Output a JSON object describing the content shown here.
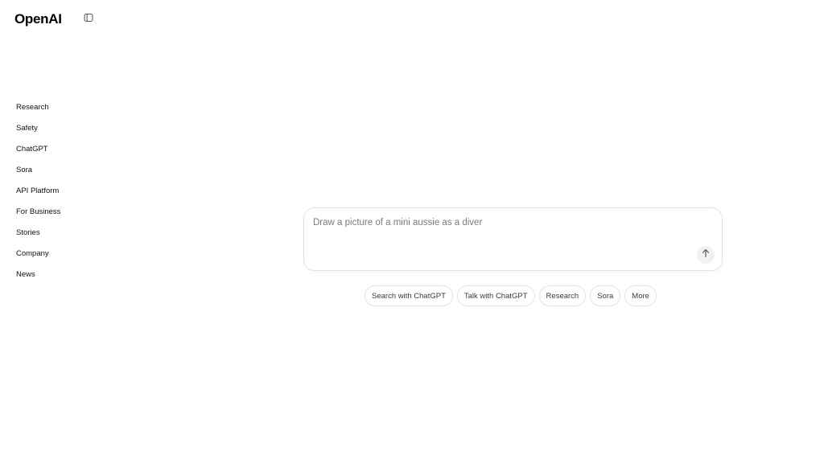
{
  "header": {
    "logo_text": "OpenAI",
    "sidebar_toggle_icon": "sidebar-toggle-icon"
  },
  "nav": {
    "items": [
      {
        "label": "Research"
      },
      {
        "label": "Safety"
      },
      {
        "label": "ChatGPT"
      },
      {
        "label": "Sora"
      },
      {
        "label": "API Platform"
      },
      {
        "label": "For Business"
      },
      {
        "label": "Stories"
      },
      {
        "label": "Company"
      },
      {
        "label": "News"
      }
    ]
  },
  "prompt": {
    "placeholder": "Draw a picture of a mini aussie as a diver",
    "send_icon": "arrow-up-icon"
  },
  "chips": [
    {
      "label": "Search with ChatGPT"
    },
    {
      "label": "Talk with ChatGPT"
    },
    {
      "label": "Research"
    },
    {
      "label": "Sora"
    },
    {
      "label": "More"
    }
  ],
  "colors": {
    "background": "#ffffff",
    "text": "#0d0d0d",
    "border": "#e3e3e3",
    "placeholder": "#7a7a7a",
    "send_button_bg": "#f1f1f1"
  }
}
